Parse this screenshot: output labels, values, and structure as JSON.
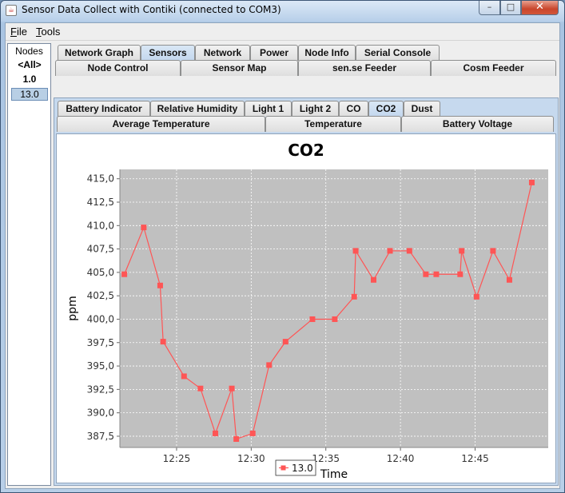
{
  "window": {
    "title": "Sensor Data Collect with Contiki (connected to COM3)",
    "min_glyph": "–",
    "max_glyph": "□",
    "close_glyph": "✕"
  },
  "menubar": {
    "items": [
      {
        "label": "File",
        "mnemonic": "F",
        "rest": "ile"
      },
      {
        "label": "Tools",
        "mnemonic": "T",
        "rest": "ools"
      }
    ]
  },
  "nodes": {
    "title": "Nodes",
    "items": [
      "<All>",
      "1.0",
      "13.0"
    ],
    "selected": "13.0"
  },
  "tabs_row1": [
    "Network Graph",
    "Sensors",
    "Network",
    "Power",
    "Node Info",
    "Serial Console"
  ],
  "tabs_row2": [
    "Node Control",
    "Sensor Map",
    "sen.se Feeder",
    "Cosm Feeder"
  ],
  "tabs_row1_active": "Sensors",
  "subtabs_row1": [
    "Battery Indicator",
    "Relative Humidity",
    "Light 1",
    "Light 2",
    "CO",
    "CO2",
    "Dust"
  ],
  "subtabs_row2": [
    "Average Temperature",
    "Temperature",
    "Battery Voltage"
  ],
  "subtabs_row1_active": "CO2",
  "colors": {
    "plot_background": "#c0c0c0",
    "series": "#ff5555",
    "selected_node": "#b8cfe5"
  },
  "chart_data": {
    "type": "line",
    "title": "CO2",
    "xlabel": "Time",
    "ylabel": "ppm",
    "x_unit": "time (HH:MM)",
    "x_ticks": [
      "12:25",
      "12:30",
      "12:35",
      "12:40",
      "12:45"
    ],
    "y_ticks": [
      "387,5",
      "390,0",
      "392,5",
      "395,0",
      "397,5",
      "400,0",
      "402,5",
      "405,0",
      "407,5",
      "410,0",
      "412,5",
      "415,0"
    ],
    "xlim": [
      "12:21.2",
      "12:49.9"
    ],
    "ylim": [
      386.3,
      416.0
    ],
    "grid": true,
    "legend_position": "bottom",
    "series": [
      {
        "name": "13.0",
        "marker": "square",
        "points": [
          [
            "12:21.5",
            404.8
          ],
          [
            "12:22.8",
            409.8
          ],
          [
            "12:23.9",
            403.6
          ],
          [
            "12:24.1",
            397.6
          ],
          [
            "12:25.5",
            393.9
          ],
          [
            "12:26.6",
            392.6
          ],
          [
            "12:27.6",
            387.8
          ],
          [
            "12:28.7",
            392.6
          ],
          [
            "12:29.0",
            387.2
          ],
          [
            "12:30.1",
            387.8
          ],
          [
            "12:31.2",
            395.1
          ],
          [
            "12:32.3",
            397.6
          ],
          [
            "12:34.1",
            400.0
          ],
          [
            "12:35.6",
            400.0
          ],
          [
            "12:36.9",
            402.4
          ],
          [
            "12:37.0",
            407.3
          ],
          [
            "12:38.2",
            404.2
          ],
          [
            "12:39.3",
            407.3
          ],
          [
            "12:40.6",
            407.3
          ],
          [
            "12:41.7",
            404.8
          ],
          [
            "12:42.4",
            404.8
          ],
          [
            "12:44.0",
            404.8
          ],
          [
            "12:44.1",
            407.3
          ],
          [
            "12:45.1",
            402.4
          ],
          [
            "12:46.2",
            407.3
          ],
          [
            "12:47.3",
            404.2
          ],
          [
            "12:48.8",
            414.6
          ]
        ]
      }
    ]
  }
}
